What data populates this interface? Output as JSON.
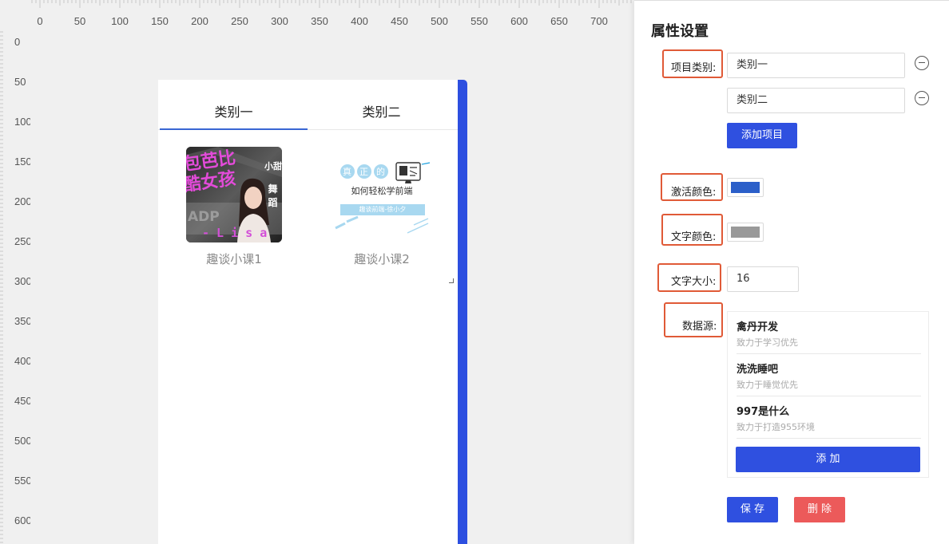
{
  "ruler": {
    "x_labels": [
      "0",
      "50",
      "100",
      "150",
      "200",
      "250",
      "300",
      "350",
      "400",
      "450",
      "500",
      "550",
      "600",
      "650",
      "700"
    ],
    "y_labels": [
      "0",
      "50",
      "100",
      "150",
      "200",
      "250",
      "300",
      "350",
      "400",
      "450",
      "500",
      "550",
      "600"
    ]
  },
  "device": {
    "tabs": [
      {
        "label": "类别一",
        "active": true
      },
      {
        "label": "类别二",
        "active": false
      }
    ],
    "active_color": "#3966d3",
    "cards": [
      {
        "title": "趣谈小课1",
        "thumb_text": [
          "包芭比",
          "酷女孩",
          "小甜",
          "舞蹈",
          "- L i s a",
          "ADP"
        ]
      },
      {
        "title": "趣谈小课2",
        "thumb_bubbles": [
          "真",
          "正",
          "的"
        ],
        "thumb_main": "如何轻松学前端",
        "thumb_tag": "趣谈前端-徐小夕"
      }
    ]
  },
  "props": {
    "title": "属性设置",
    "category_label": "项目类别",
    "categories": [
      "类别一",
      "类别二"
    ],
    "add_item_label": "添加项目",
    "active_color_label": "激活颜色",
    "active_color": "#2b5fc9",
    "text_color_label": "文字颜色",
    "text_color": "#999999",
    "font_size_label": "文字大小",
    "font_size": "16",
    "datasource_label": "数据源",
    "datasource": [
      {
        "name": "禽丹开发",
        "desc": "致力于学习优先"
      },
      {
        "name": "洗洗睡吧",
        "desc": "致力于睡觉优先"
      },
      {
        "name": "997是什么",
        "desc": "致力于打造955环境"
      }
    ],
    "add_label": "添 加",
    "save_label": "保 存",
    "delete_label": "删 除"
  }
}
